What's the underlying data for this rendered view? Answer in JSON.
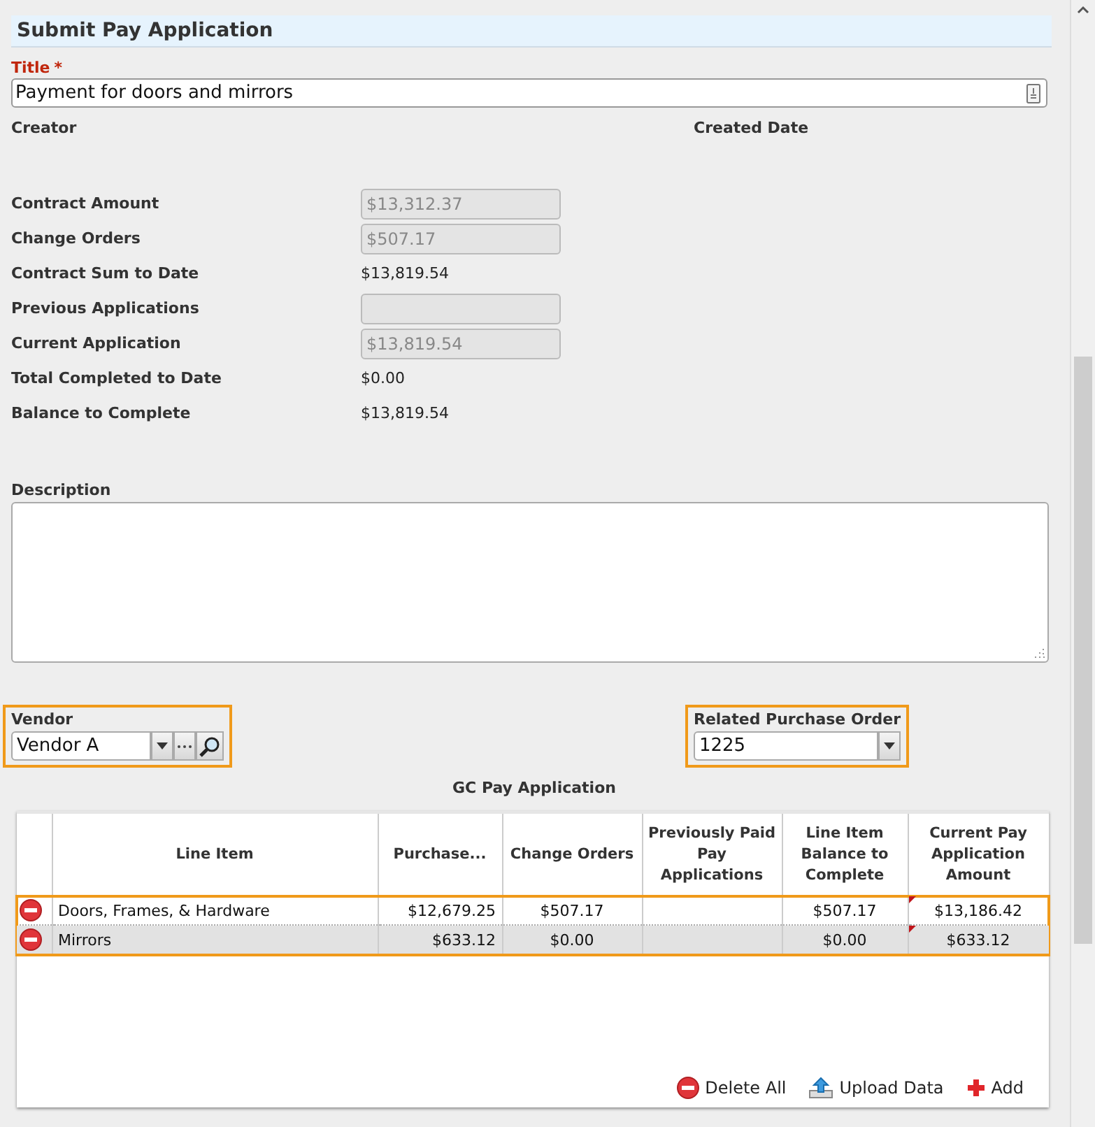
{
  "header": {
    "title": "Submit Pay Application"
  },
  "title_field": {
    "label": "Title",
    "required_mark": "*",
    "value": "Payment for doors and mirrors"
  },
  "meta": [
    {
      "label": "Creator"
    },
    {
      "label": "Created Date"
    }
  ],
  "amounts": [
    {
      "label": "Contract Amount",
      "kind": "field",
      "value": "$13,312.37"
    },
    {
      "label": "Change Orders",
      "kind": "field",
      "value": "$507.17"
    },
    {
      "label": "Contract Sum to Date",
      "kind": "text",
      "value": "$13,819.54"
    },
    {
      "label": "Previous Applications",
      "kind": "field"
    },
    {
      "label": "Current Application",
      "kind": "field",
      "value": "$13,819.54"
    },
    {
      "label": "Total Completed to Date",
      "kind": "text",
      "value": "$0.00"
    },
    {
      "label": "Balance to Complete",
      "kind": "text",
      "value": "$13,819.54"
    }
  ],
  "description": {
    "label": "Description"
  },
  "vendor": {
    "label": "Vendor",
    "value": "Vendor A"
  },
  "purchase_order": {
    "label": "Related Purchase Order",
    "value": "1225"
  },
  "grid": {
    "title": "GC Pay Application",
    "columns": [
      "Line Item",
      "Purchase...",
      "Change Orders",
      "Previously Paid Pay Applications",
      "Line Item Balance to Complete",
      "Current Pay Application Amount"
    ],
    "rows": [
      {
        "cells": [
          "Doors, Frames, & Hardware",
          "$12,679.25",
          "$507.17",
          "",
          "$507.17",
          "$13,186.42"
        ],
        "flagged": true
      },
      {
        "cells": [
          "Mirrors",
          "$633.12",
          "$0.00",
          "",
          "$0.00",
          "$633.12"
        ],
        "flagged": true
      }
    ],
    "actions": [
      {
        "label": "Delete All",
        "kind": "delete"
      },
      {
        "label": "Upload Data",
        "kind": "upload"
      },
      {
        "label": "Add",
        "kind": "add"
      }
    ]
  }
}
